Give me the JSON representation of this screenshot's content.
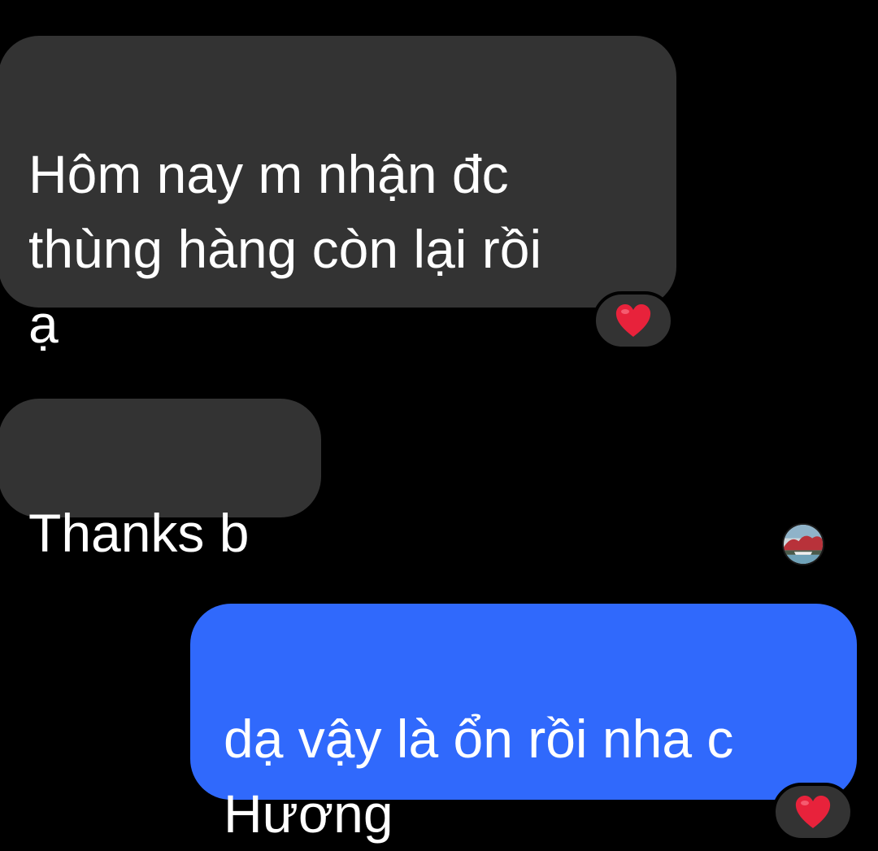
{
  "conversation": {
    "messages": [
      {
        "sender": "contact",
        "text": "Hôm nay m nhận đc\nthùng hàng còn lại rồi\nạ",
        "reaction": "heart"
      },
      {
        "sender": "contact",
        "text": "Thanks b"
      },
      {
        "sender": "me",
        "text": "dạ vậy là ổn rồi nha c\nHương",
        "reaction": "heart"
      }
    ]
  },
  "icons": {
    "reaction": "heart-icon",
    "read_receipt": "seen-avatar"
  },
  "colors": {
    "background": "#000000",
    "incoming_bubble": "#333333",
    "outgoing_bubble": "#3069fc",
    "heart": "#e8223b"
  }
}
